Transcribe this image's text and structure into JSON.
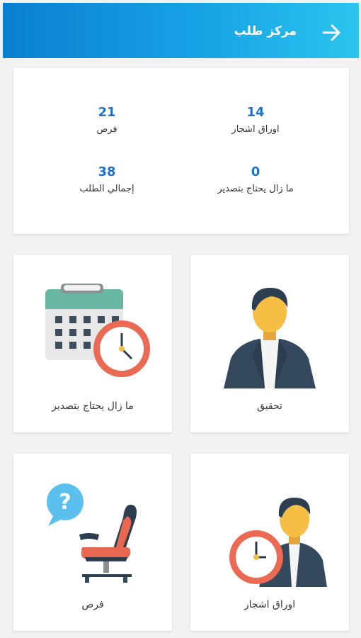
{
  "header": {
    "title": "مركز طلب",
    "back_icon": "arrow-right-icon",
    "colors": {
      "start": "#0a7fd2",
      "end": "#2bc4ee"
    }
  },
  "stats": [
    {
      "value": "14",
      "label": "اوراق اشجار"
    },
    {
      "value": "21",
      "label": "فرص"
    },
    {
      "value": "0",
      "label": "ما زال يحتاج بتصدير"
    },
    {
      "value": "38",
      "label": "إجمالي الطلب"
    }
  ],
  "tiles": [
    {
      "label": "تحقيق",
      "icon": "businessman-icon"
    },
    {
      "label": "ما زال يحتاج بتصدير",
      "icon": "calendar-clock-icon"
    },
    {
      "label": "اوراق اشجار",
      "icon": "businessman-clock-icon"
    },
    {
      "label": "فرص",
      "icon": "empty-chair-question-icon"
    }
  ],
  "accent_color": "#1e73c8"
}
